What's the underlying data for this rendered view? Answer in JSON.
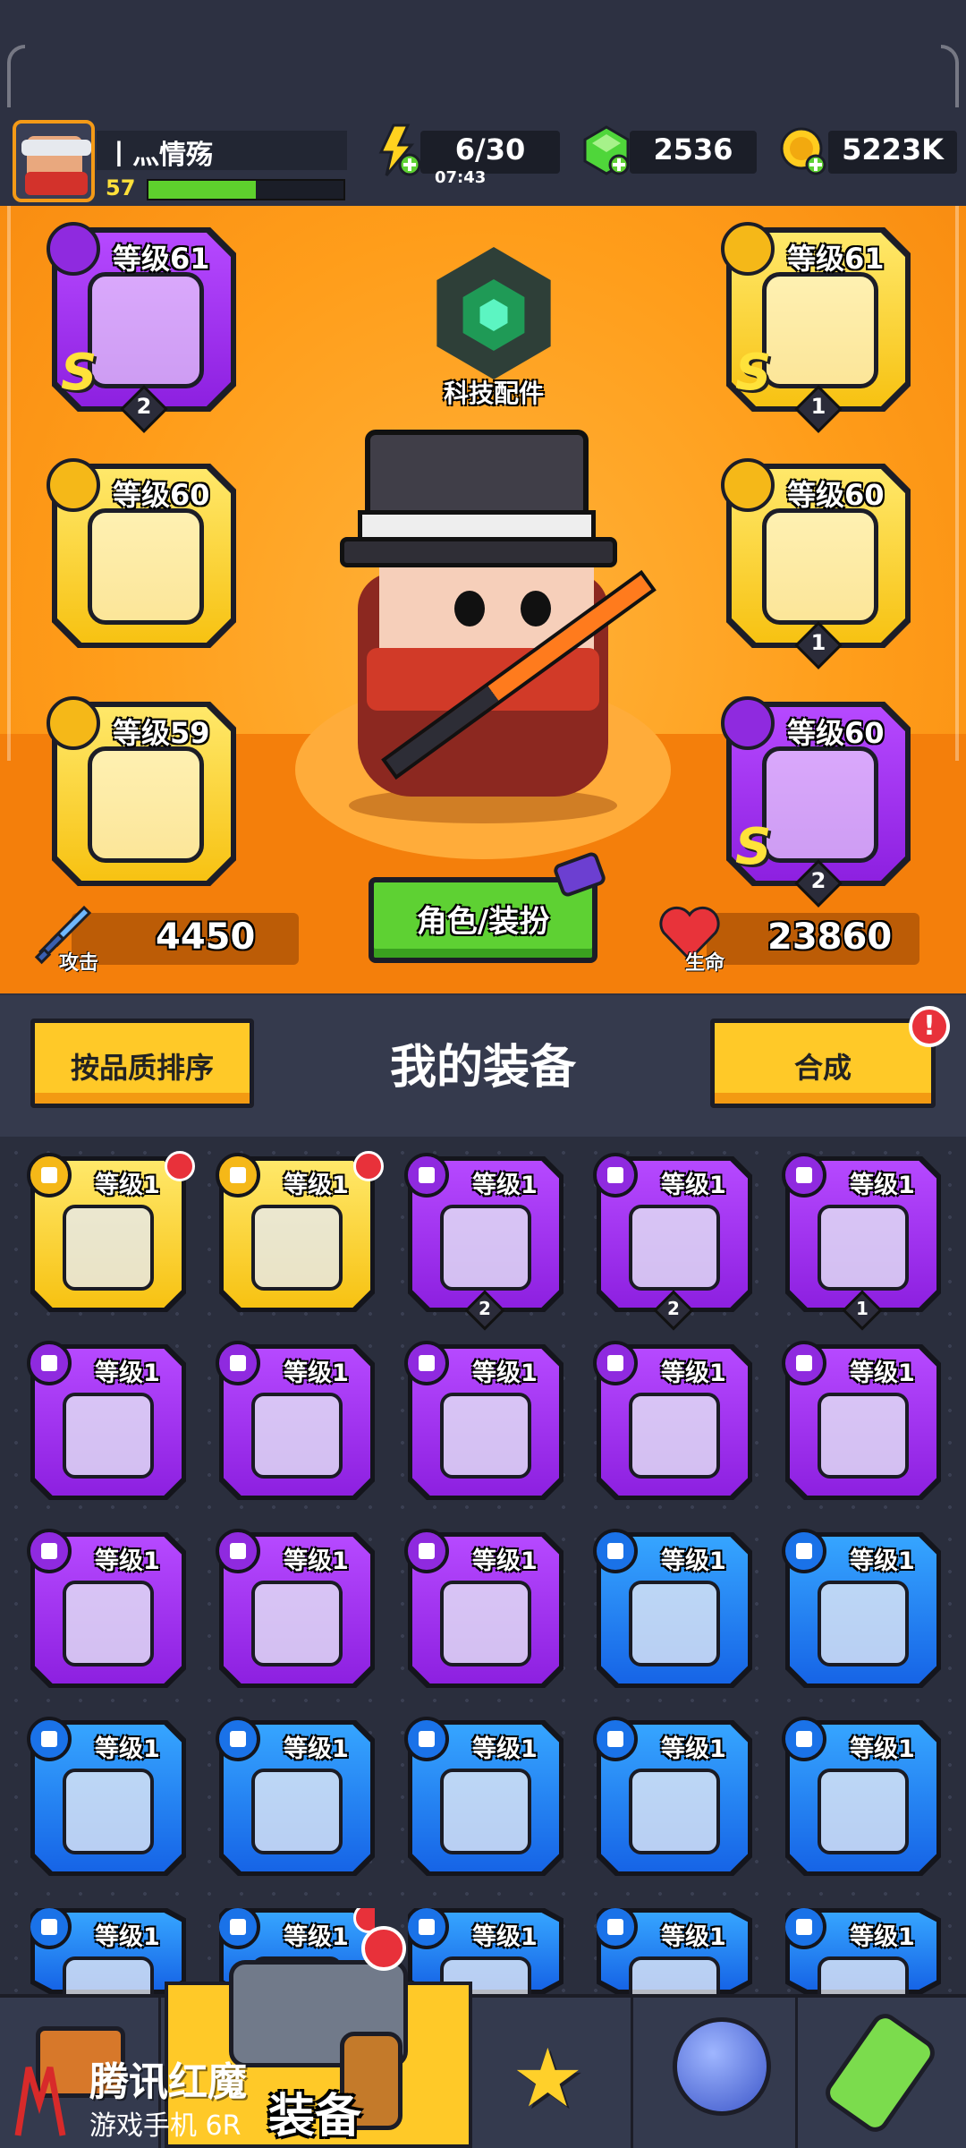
{
  "player": {
    "name": "丨灬情殇",
    "level": "57",
    "xp_progress": 0.55
  },
  "resources": {
    "energy": "6/30",
    "energy_timer": "07:43",
    "gems": "2536",
    "coins": "5223K"
  },
  "hero": {
    "tech_label": "科技配件",
    "role_button": "角色/装扮",
    "attack_label": "攻击",
    "attack_value": "4450",
    "hp_label": "生命",
    "hp_value": "23860"
  },
  "equipped": [
    {
      "level": "等级61",
      "grade": "S",
      "stars": "2",
      "rarity": "purple",
      "icon": "weapon-icon"
    },
    {
      "level": "等级60",
      "grade": "",
      "stars": "",
      "rarity": "yellow",
      "icon": "necklace-icon"
    },
    {
      "level": "等级59",
      "grade": "",
      "stars": "",
      "rarity": "yellow",
      "icon": "glove-icon"
    },
    {
      "level": "等级61",
      "grade": "S",
      "stars": "1",
      "rarity": "yellow",
      "icon": "armor-icon"
    },
    {
      "level": "等级60",
      "grade": "",
      "stars": "1",
      "rarity": "yellow",
      "icon": "belt-icon"
    },
    {
      "level": "等级60",
      "grade": "S",
      "stars": "2",
      "rarity": "purple",
      "icon": "boots-icon"
    }
  ],
  "panel": {
    "sort_button": "按品质排序",
    "title": "我的装备",
    "craft_button": "合成",
    "craft_alert": "!"
  },
  "inventory": [
    {
      "level": "等级1",
      "rarity": "yellow",
      "stars": "",
      "new": true,
      "icon": "kunai-icon"
    },
    {
      "level": "等级1",
      "rarity": "yellow",
      "stars": "",
      "new": true,
      "icon": "boots-icon"
    },
    {
      "level": "等级1",
      "rarity": "purple",
      "stars": "2",
      "new": false,
      "icon": "spiked-collar-icon"
    },
    {
      "level": "等级1",
      "rarity": "purple",
      "stars": "2",
      "new": false,
      "icon": "claw-glove-icon"
    },
    {
      "level": "等级1",
      "rarity": "purple",
      "stars": "1",
      "new": false,
      "icon": "claw-glove-icon"
    },
    {
      "level": "等级1",
      "rarity": "purple",
      "stars": "",
      "new": false,
      "icon": "machete-icon"
    },
    {
      "level": "等级1",
      "rarity": "purple",
      "stars": "",
      "new": false,
      "icon": "revolver-icon"
    },
    {
      "level": "等级1",
      "rarity": "purple",
      "stars": "",
      "new": false,
      "icon": "torch-icon"
    },
    {
      "level": "等级1",
      "rarity": "purple",
      "stars": "",
      "new": false,
      "icon": "badge-necklace-icon"
    },
    {
      "level": "等级1",
      "rarity": "purple",
      "stars": "",
      "new": false,
      "icon": "rope-belt-icon"
    },
    {
      "level": "等级1",
      "rarity": "purple",
      "stars": "",
      "new": false,
      "icon": "boots-icon"
    },
    {
      "level": "等级1",
      "rarity": "purple",
      "stars": "",
      "new": false,
      "icon": "boots-icon"
    },
    {
      "level": "等级1",
      "rarity": "purple",
      "stars": "",
      "new": false,
      "icon": "boots-icon"
    },
    {
      "level": "等级1",
      "rarity": "blue",
      "stars": "",
      "new": false,
      "icon": "kunai-icon"
    },
    {
      "level": "等级1",
      "rarity": "blue",
      "stars": "",
      "new": false,
      "icon": "revolver-icon"
    },
    {
      "level": "等级1",
      "rarity": "blue",
      "stars": "",
      "new": false,
      "icon": "shotgun-icon"
    },
    {
      "level": "等级1",
      "rarity": "blue",
      "stars": "",
      "new": false,
      "icon": "shotgun-icon"
    },
    {
      "level": "等级1",
      "rarity": "blue",
      "stars": "",
      "new": false,
      "icon": "vest-icon"
    },
    {
      "level": "等级1",
      "rarity": "blue",
      "stars": "",
      "new": false,
      "icon": "vest-icon"
    },
    {
      "level": "等级1",
      "rarity": "blue",
      "stars": "",
      "new": false,
      "icon": "jacket-icon"
    },
    {
      "level": "等级1",
      "rarity": "blue",
      "stars": "",
      "new": false,
      "icon": "armor-icon"
    },
    {
      "level": "等级1",
      "rarity": "blue",
      "stars": "",
      "new": true,
      "icon": "armor-icon"
    },
    {
      "level": "等级1",
      "rarity": "blue",
      "stars": "",
      "new": false,
      "icon": "armor-icon"
    },
    {
      "level": "等级1",
      "rarity": "blue",
      "stars": "",
      "new": false,
      "icon": "armor-icon"
    },
    {
      "level": "等级1",
      "rarity": "blue",
      "stars": "",
      "new": false,
      "icon": "shirt-icon"
    }
  ],
  "nav": {
    "active_label": "装备"
  },
  "watermark": {
    "title": "腾讯红魔",
    "subtitle": "游戏手机 6R"
  },
  "colors": {
    "purple": "#a53bf5",
    "yellow": "#f9d022",
    "blue": "#2384f5",
    "accent_green": "#5ed133",
    "hero_orange": "#ff9d1a"
  }
}
